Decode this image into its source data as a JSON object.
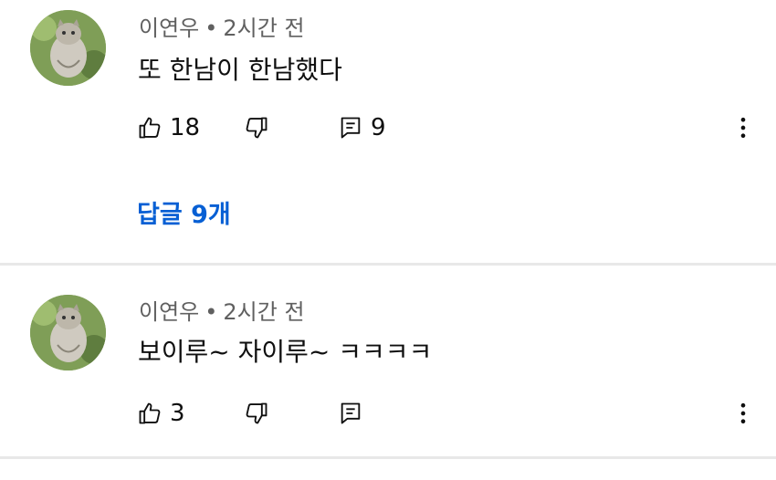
{
  "comments": [
    {
      "author": "이연우",
      "separator": "•",
      "time": "2시간 전",
      "text": "또 한남이 한남했다",
      "like_count": "18",
      "reply_count": "9",
      "replies_link": "답글 9개"
    },
    {
      "author": "이연우",
      "separator": "•",
      "time": "2시간 전",
      "text": "보이루~ 자이루~ ㅋㅋㅋㅋ",
      "like_count": "3",
      "reply_count": ""
    }
  ],
  "icons": [
    "thumbs-up-icon",
    "thumbs-down-icon",
    "reply-icon",
    "more-vert-icon"
  ],
  "colors": {
    "link": "#065fd4",
    "meta": "#606060",
    "divider": "#e8e8e8"
  }
}
